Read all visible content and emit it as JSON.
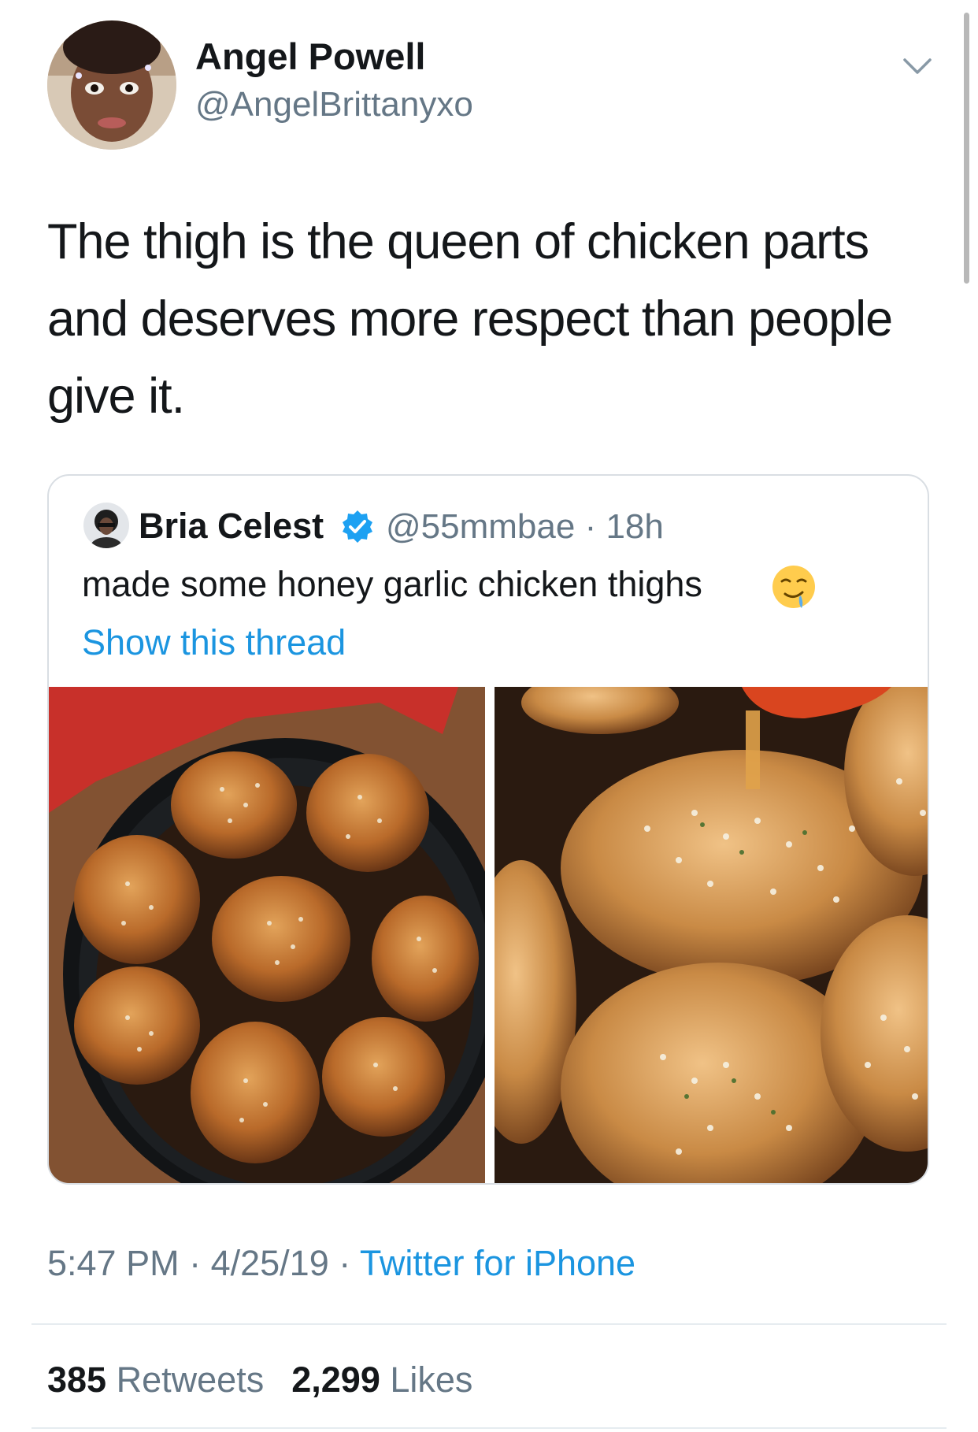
{
  "author": {
    "name": "Angel Powell",
    "handle": "@AngelBrittanyxo"
  },
  "tweet": {
    "text": "The thigh is the queen of chicken parts and deserves more respect than people give it."
  },
  "quoted_tweet": {
    "name": "Bria Celest",
    "verified": true,
    "handle": "@55mmbae",
    "separator": "·",
    "age": "18h",
    "text": "made some honey garlic chicken thighs",
    "emoji": "drooling-face",
    "show_thread": "Show this thread"
  },
  "meta": {
    "time": "5:47 PM",
    "sep1": " · ",
    "date": "4/25/19",
    "sep2": " · ",
    "source": "Twitter for iPhone"
  },
  "stats": {
    "retweets_count": "385",
    "retweets_label": "Retweets",
    "likes_count": "2,299",
    "likes_label": "Likes"
  },
  "colors": {
    "link": "#1b95e0",
    "secondary_text": "#657786",
    "verified": "#1da1f2"
  }
}
